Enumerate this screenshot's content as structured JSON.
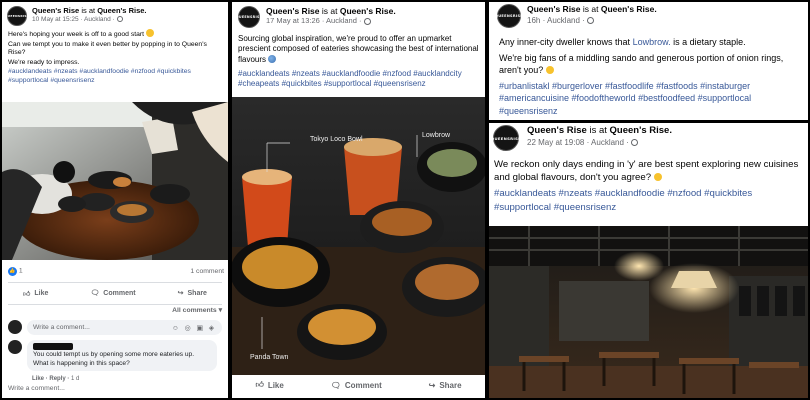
{
  "brand_logo_text": "QUEENSRISE",
  "p1": {
    "page": "Queen's Rise",
    "is_at": "is at",
    "location": "Queen's Rise.",
    "meta": "10 May at 15:25 · Auckland ·",
    "text1": "Here's hoping your week is off to a good start",
    "text2": "Can we tempt you to make it even better by popping in to Queen's Rise?",
    "text3": "We're ready to impress.",
    "tags": "#aucklandeats #nzeats #aucklandfoodie #nzfood #quickbites #supportlocal #queensrisenz",
    "reaction_count": "1",
    "comment_count": "1 comment",
    "like_label": "Like",
    "comment_label": "Comment",
    "share_label": "Share",
    "all_comments": "All comments",
    "write_placeholder": "Write a comment...",
    "comment_text": "You could tempt us by opening some more eateries up. What is happening in this space?",
    "comment_like": "Like",
    "comment_reply": "Reply",
    "comment_age": "1 d",
    "write2": "Write a comment..."
  },
  "p2": {
    "page": "Queen's Rise",
    "is_at": "is at",
    "location": "Queen's Rise.",
    "meta": "17 May at 13:26 · Auckland ·",
    "text": "Sourcing global inspiration, we're proud to offer an upmarket prescient composed of eateries showcasing the best of international flavours",
    "tags": "#aucklandeats #nzeats #aucklandfoodie #nzfood #aucklandcity #cheapeats #quickbites #supportlocal #queensrisenz",
    "label_tokyo": "Tokyo Loco Bowl",
    "label_lowbrow": "Lowbrow",
    "label_panda": "Panda Town",
    "like_label": "Like",
    "comment_label": "Comment",
    "share_label": "Share"
  },
  "p3": {
    "page": "Queen's Rise",
    "is_at": "is at",
    "location": "Queen's Rise.",
    "meta": "16h · Auckland ·",
    "text1_a": "Any inner-city dweller knows that",
    "text1_link": "Lowbrow.",
    "text1_b": "is a dietary staple.",
    "text2": "We're big fans of a middling sando and generous portion of onion rings, aren't you?",
    "tags": "#urbanlistakl #burgerlover #fastfoodlife #fastfoods #instaburger #americancuisine #foodoftheworld #bestfoodfeed #supportlocal #queensrisenz"
  },
  "p4": {
    "page": "Queen's Rise",
    "is_at": "is at",
    "location": "Queen's Rise.",
    "meta": "22 May at 19:08 · Auckland ·",
    "text": "We reckon only days ending in 'y' are best spent exploring new cuisines and global flavours, don't you agree?",
    "tags": "#aucklandeats #nzeats #aucklandfoodie #nzfood #quickbites #supportlocal #queensrisenz"
  },
  "colors": {
    "link": "#385898",
    "like_blue": "#1877f2",
    "meta_grey": "#65676b"
  }
}
